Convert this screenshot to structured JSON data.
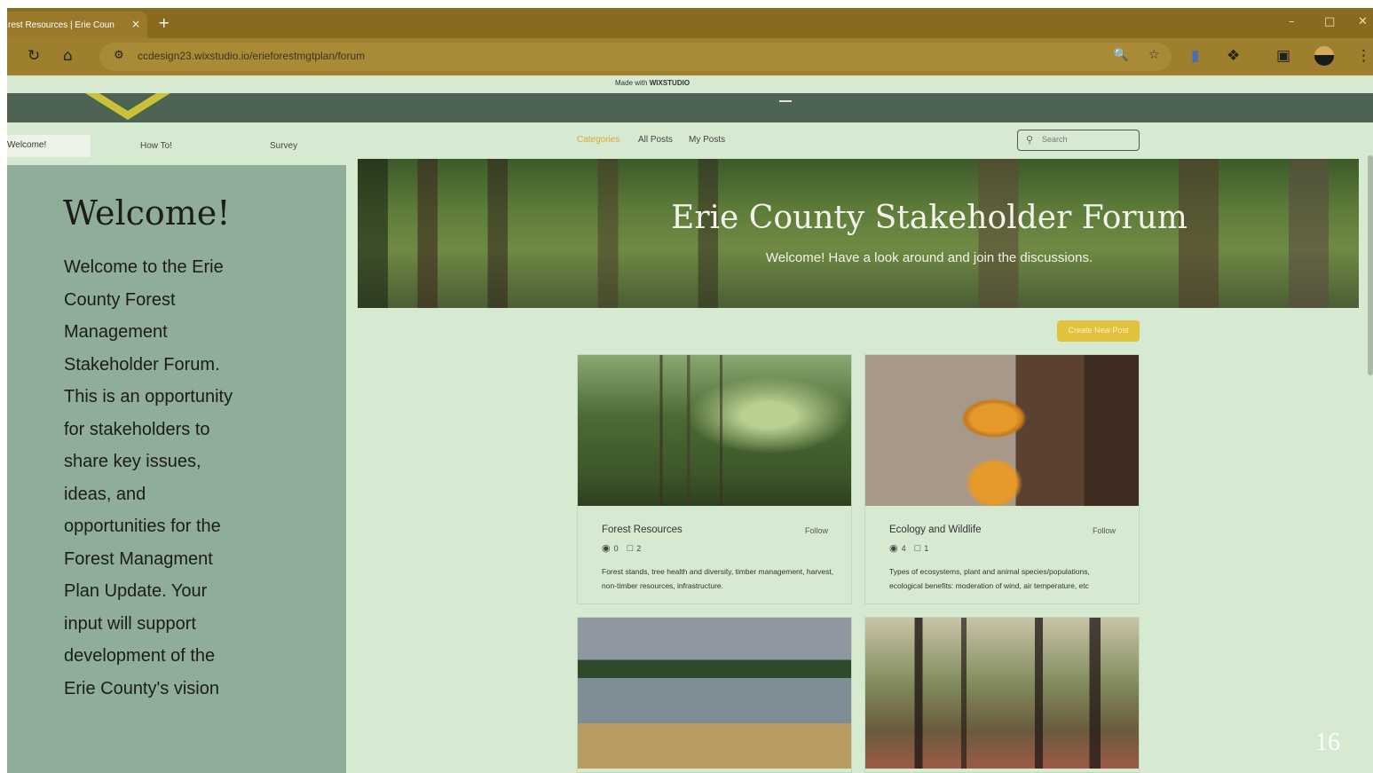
{
  "browser": {
    "tab_title": "rest Resources | Erie Coun",
    "tab_close": "×",
    "new_tab": "+",
    "url": "ccdesign23.wixstudio.io/erieforestmgtplan/forum",
    "icons": [
      "reload-icon",
      "home-icon",
      "site-info-icon",
      "zoom-icon",
      "star-icon",
      "extension-icon",
      "puzzle-icon",
      "sidepanel-icon",
      "menu-icon"
    ]
  },
  "wix": {
    "made_with": "Made with",
    "brand": "WIXSTUDIO"
  },
  "nav": {
    "items": [
      "Welcome!",
      "How To!",
      "Survey"
    ],
    "forum_tabs": [
      "Categories",
      "All Posts",
      "My Posts"
    ],
    "search_placeholder": "Search"
  },
  "left_panel": {
    "title": "Welcome!",
    "text": "Welcome to the Erie County Forest Management Stakeholder Forum. This is an opportunity for stakeholders to share key issues, ideas, and opportunities for the Forest Managment Plan Update. Your input will support development  of the Erie County's vision"
  },
  "hero": {
    "title": "Erie County Stakeholder Forum",
    "subtitle": "Welcome! Have a look around and join the discussions."
  },
  "create_post": "Create New Post",
  "cards": [
    {
      "title": "Forest Resources",
      "follow": "Follow",
      "views": "0",
      "comments": "2",
      "description": "Forest stands, tree health and diversity, timber management, harvest, non-timber resources, infrastructure."
    },
    {
      "title": "Ecology and Wildlife",
      "follow": "Follow",
      "views": "4",
      "comments": "1",
      "description": "Types of ecosystems, plant and animal species/populations, ecological benefits: moderation of wind, air temperature, etc"
    }
  ],
  "slide_number": "16",
  "colors": {
    "page_bg": "#d6ead2",
    "header_green": "#4e6452",
    "left_panel": "#8fad98",
    "accent_gold": "#e2c23c",
    "category_gold": "#d7a93a",
    "browser_brown": "#9e7f2e"
  }
}
